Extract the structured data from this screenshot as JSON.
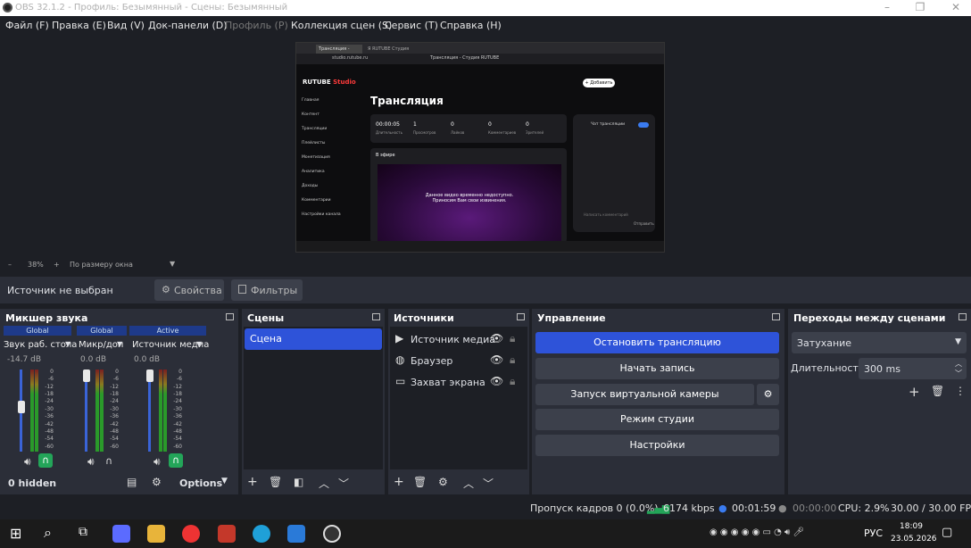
{
  "window": {
    "title": "OBS 32.1.2 - Профиль: Безымянный - Сцены: Безымянный",
    "min": "–",
    "max": "❐",
    "close": "✕"
  },
  "menu": [
    "Файл (F)",
    "Правка (E)",
    "Вид (V)",
    "Док-панели (D)",
    "Профиль (P)",
    "Коллекция сцен (S)",
    "Сервис (T)",
    "Справка (H)"
  ],
  "preview": {
    "browser_tab1": "Трансляция - студия",
    "browser_tab2": "Я RUTUBE Студия",
    "address": "studio.rutube.ru",
    "page_title": "Трансляция - Студия RUTUBE",
    "site_brand": "RUTUBE",
    "site_brand2": "Studio",
    "heading": "Трансляция",
    "stats": [
      {
        "value": "00:00:05",
        "label": "Длительность"
      },
      {
        "value": "1",
        "label": "Просмотров"
      },
      {
        "value": "0",
        "label": "Лайков"
      },
      {
        "value": "0",
        "label": "Комментариев"
      },
      {
        "value": "0",
        "label": "Зрителей"
      }
    ],
    "live_label": "В эфире",
    "notice": "Данное видео временно недоступно. Приносим Вам свои извинения.",
    "create_btn": "+ Добавить",
    "nav": [
      "Главная",
      "Контент",
      "Трансляции",
      "Плейлисты",
      "Монетизация",
      "Аналитика",
      "Доходы",
      "Комментарии",
      "Настройки канала"
    ],
    "chat_label": "Чат трансляции",
    "chat_send": "Отправить",
    "chat_placeholder": "Написать комментарий"
  },
  "zoombar": {
    "minus": "–",
    "zoom": "38%",
    "plus": "+",
    "fit": "По размеру окна"
  },
  "source_bar": {
    "status": "Источник не выбран",
    "properties": "Свойства",
    "filters": "Фильтры"
  },
  "mixer": {
    "title": "Микшер звука",
    "channels": [
      {
        "tab": "Global",
        "name": "Звук раб. стола",
        "db": "-14.7 dB",
        "level": 0.55
      },
      {
        "tab": "Global",
        "name": "Микр/доп",
        "db": "0.0 dB",
        "level": 1.0
      },
      {
        "tab": "Active",
        "name": "Источник медиа",
        "db": "0.0 dB",
        "level": 1.0
      }
    ],
    "scale": [
      "0",
      "-6",
      "-12",
      "-18",
      "-24",
      "-30",
      "-36",
      "-42",
      "-48",
      "-54",
      "-60"
    ],
    "footer_hidden": "0 hidden",
    "footer_options": "Options"
  },
  "scenes": {
    "title": "Сцены",
    "items": [
      "Сцена"
    ]
  },
  "sources": {
    "title": "Источники",
    "items": [
      {
        "name": "Источник медиа",
        "icon": "play-icon"
      },
      {
        "name": "Браузер",
        "icon": "globe-icon"
      },
      {
        "name": "Захват экрана",
        "icon": "monitor-icon"
      }
    ]
  },
  "controls": {
    "title": "Управление",
    "stop_stream": "Остановить трансляцию",
    "start_record": "Начать запись",
    "virtual_cam": "Запуск виртуальной камеры",
    "studio_mode": "Режим студии",
    "settings": "Настройки"
  },
  "transitions": {
    "title": "Переходы между сценами",
    "type": "Затухание",
    "duration_label": "Длительность",
    "duration": "300 ms"
  },
  "status": {
    "dropped": "Пропуск кадров 0 (0.0%)",
    "bitrate": "6174 kbps",
    "stream_time": "00:01:59",
    "record_time": "00:00:00",
    "cpu": "CPU: 2.9%",
    "fps": "30.00 / 30.00 FPS"
  },
  "taskbar": {
    "lang": "РУС",
    "time": "18:09",
    "date": "23.05.2026"
  },
  "colors": {
    "accent": "#2e53d9",
    "dock": "#2b2e38",
    "bg": "#1d1f25"
  }
}
